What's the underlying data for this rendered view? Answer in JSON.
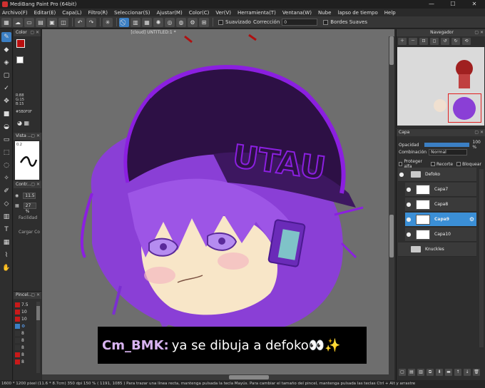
{
  "window": {
    "title": "MediBang Paint Pro (64bit)",
    "min": "—",
    "max": "☐",
    "close": "✕"
  },
  "menu": [
    "Archivo(F)",
    "Editar(E)",
    "Capa(L)",
    "Filtro(R)",
    "Seleccionar(S)",
    "Ajustar(M)",
    "Color(C)",
    "Ver(V)",
    "Herramienta(T)",
    "Ventana(W)",
    "Nube",
    "lapso de tiempo",
    "Help"
  ],
  "toolbar": {
    "suavizado": "Suavizado",
    "correccion": "Corrección",
    "correccion_value": "0",
    "bordes": "Bordes Suaves"
  },
  "color_panel": {
    "title": "Color",
    "r": "R:B8",
    "g": "G:15",
    "b": "B:15",
    "hex": "#5B0F0F",
    "fg_color": "#b80f0f"
  },
  "vista_panel": {
    "title": "Vista ...",
    "size": "0.2"
  },
  "contr_panel": {
    "title": "Contr...",
    "size": "11.5",
    "opacity": "27 %",
    "facilidad": "Facilidad",
    "cargar": "Cargar Co"
  },
  "brush_panel": {
    "title": "Pincel...",
    "items": [
      "7.5",
      "10",
      "10",
      "8",
      "8",
      "8",
      "8",
      "8"
    ]
  },
  "document": {
    "tab": "[cloud] UNTITLED:1 *"
  },
  "caption": {
    "user": "Cm_BMK:",
    "message": "ya se dibuja a defoko👀✨"
  },
  "navigator": {
    "title": "Navegador"
  },
  "layers": {
    "title": "Capa",
    "opacity_label": "Opacidad",
    "opacity_value": "100 %",
    "opacity_fraction": 1.0,
    "blend_label": "Combinación",
    "blend_value": "Normal",
    "protect": "Proteger alfa",
    "clip": "Recorte",
    "lock": "Bloquear",
    "items": [
      "Defoko",
      "Capa7",
      "Capa8",
      "Capa9",
      "Capa10",
      "Knuckles"
    ],
    "selected": "Capa9"
  },
  "status": "1600 * 1200 pixel  (11.6 * 8.7cm)  350 dpi  150 %  ( 1191, 1085 )  Para trazar una línea recta, mantenga pulsada la tecla Mayús. Para cambiar el tamaño del pincel, mantenga pulsada las teclas Ctrl + Alt y arrastre",
  "colors": {
    "accent": "#3b7fc4",
    "hair": "#8a3fd6",
    "cap": "#2d1045",
    "outline": "#8b1fe0",
    "skin": "#f8e6c8"
  }
}
